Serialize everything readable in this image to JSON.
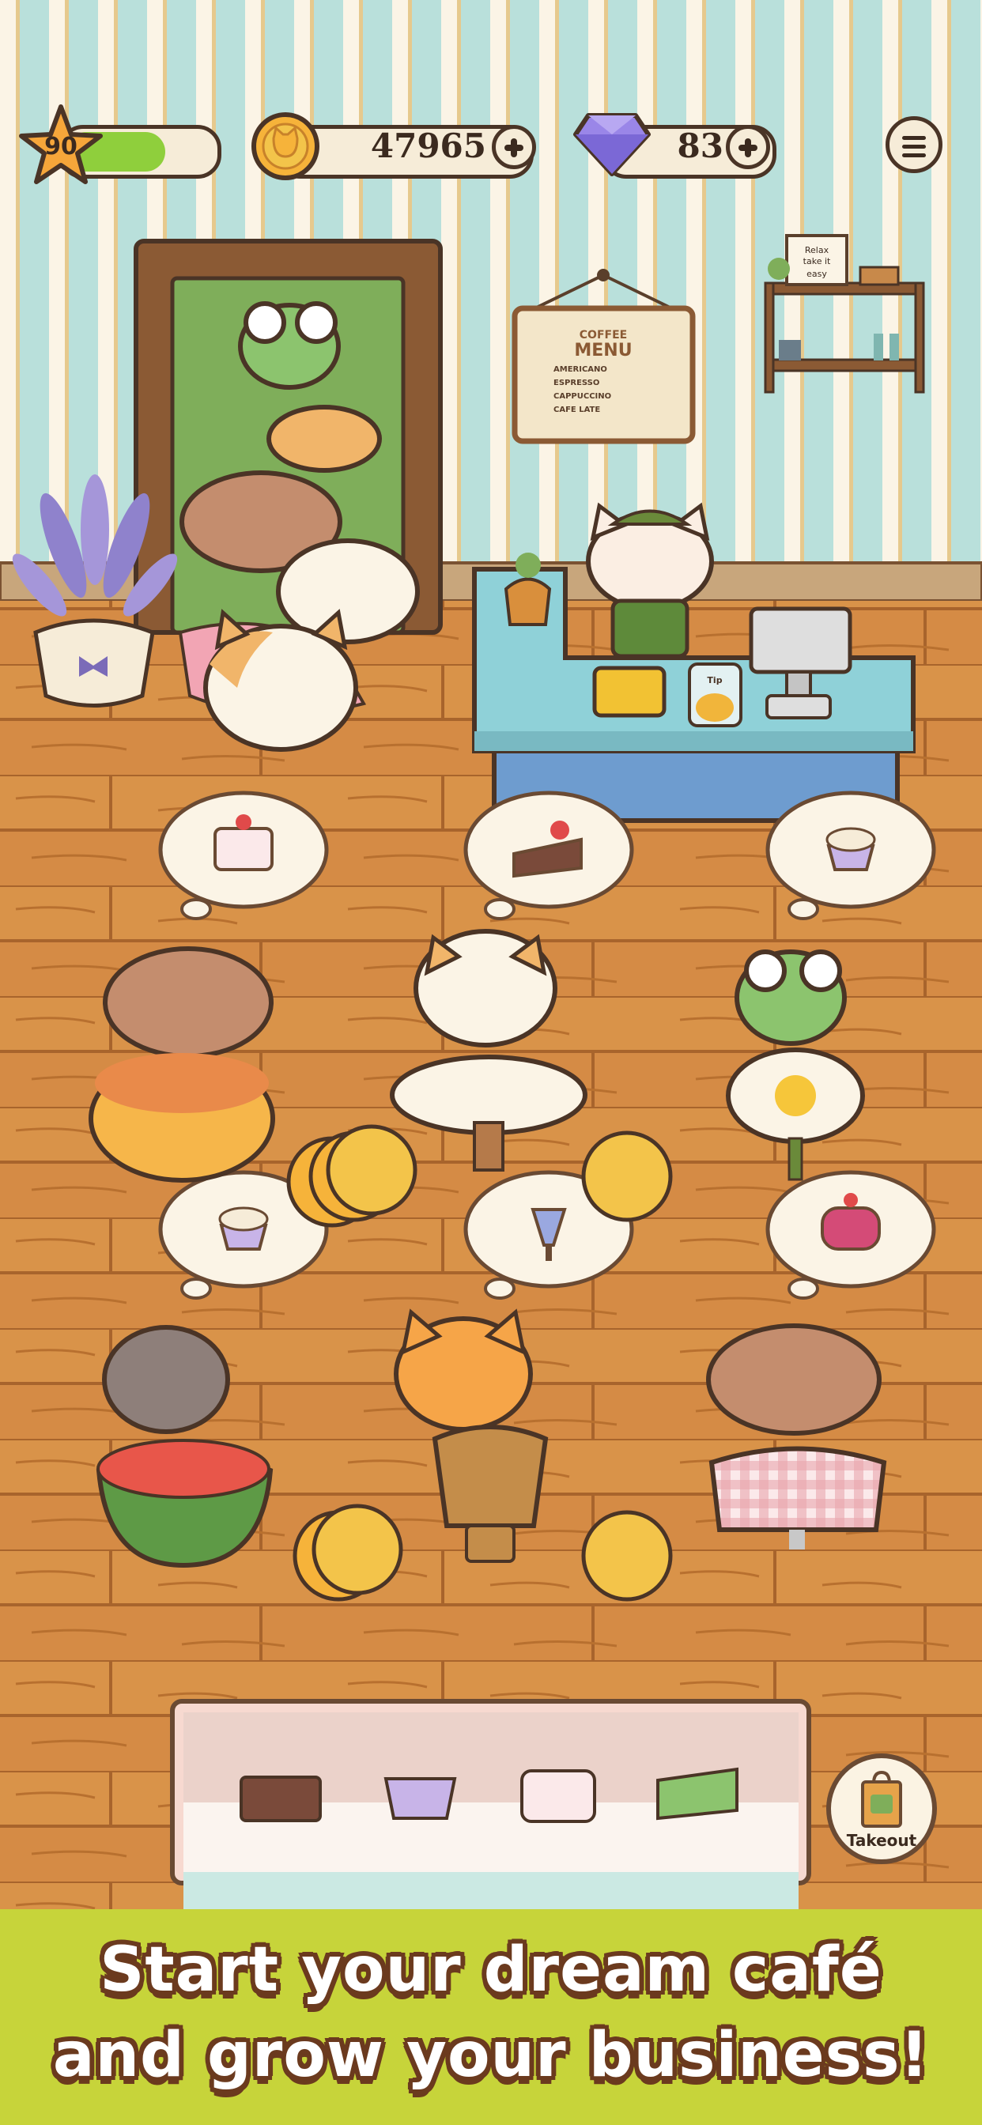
{
  "hud": {
    "level": "90",
    "xp_progress": 0.7,
    "coins": "47965",
    "gems": "83",
    "colors": {
      "xp_bar": "#8fcf3c",
      "accent": "#f6ecd8",
      "outline": "#4a3426"
    }
  },
  "icons": {
    "level": "star-icon",
    "coins": "cat-coin-icon",
    "gems": "purple-gem-icon",
    "menu": "hamburger-menu-icon",
    "takeout": "shopping-bag-icon"
  },
  "menu_board": {
    "heading": "COFFEE",
    "title": "MENU",
    "items": [
      "AMERICANO",
      "ESPRESSO",
      "CAPPUCCINO",
      "CAFE LATE"
    ]
  },
  "tip_jar_label": "Tip",
  "shelf_sign": [
    "Relax",
    "take it",
    "easy"
  ],
  "customers": [
    {
      "animal": "cat",
      "wants": "strawberry-cake",
      "table": "pudding"
    },
    {
      "animal": "cat",
      "wants": "chocolate-cake",
      "table": "star-tablecloth"
    },
    {
      "animal": "frog",
      "wants": "blueberry-cupcake",
      "table": "fried-egg"
    },
    {
      "animal": "raccoon",
      "wants": "blueberry-cupcake",
      "table": "watermelon"
    },
    {
      "animal": "fox",
      "wants": "parfait",
      "table": "sprinkle-dessert"
    },
    {
      "animal": "dog",
      "wants": "raspberry-cake",
      "table": "gingham"
    }
  ],
  "display_case": [
    "chocolate-strawberry-cake",
    "blueberry-cupcake",
    "tulip-cake",
    "matcha-cake"
  ],
  "takeout_label": "Takeout",
  "banner": {
    "line1": "Start your dream café",
    "line2": "and grow your business!",
    "color": "#c7d43a"
  }
}
